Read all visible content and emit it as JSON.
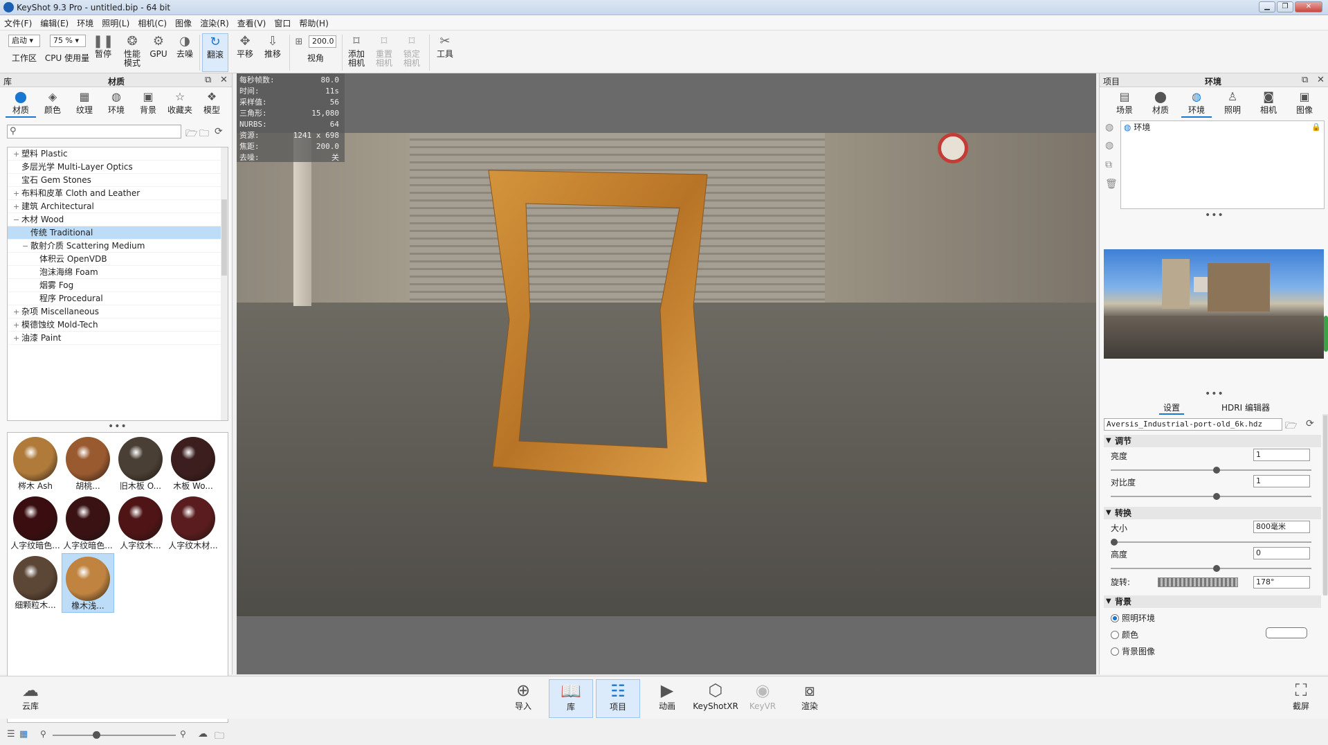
{
  "window": {
    "title": "KeyShot 9.3 Pro  - untitled.bip - 64 bit"
  },
  "menu": [
    "文件(F)",
    "编辑(E)",
    "环境",
    "照明(L)",
    "相机(C)",
    "图像",
    "渲染(R)",
    "查看(V)",
    "窗口",
    "帮助(H)"
  ],
  "toolbar": {
    "workspace_value": "启动",
    "workspace_label": "工作区",
    "cpu_value": "75 %",
    "cpu_label1": "CPU",
    "cpu_label2": "使用量",
    "pause_label": "暂停",
    "perf_label1": "性能",
    "perf_label2": "模式",
    "gpu_label": "GPU",
    "denoise_label": "去噪",
    "tumble_label": "翻滚",
    "pan_label": "平移",
    "dolly_label": "推移",
    "fov_value": "200.0",
    "fov_label": "视角",
    "addcam_label1": "添加",
    "addcam_label2": "相机",
    "resetcam_label1": "重置",
    "resetcam_label2": "相机",
    "lockcam_label1": "锁定",
    "lockcam_label2": "相机",
    "tools_label": "工具"
  },
  "library": {
    "header_left": "库",
    "header_center": "材质",
    "tabs": [
      "材质",
      "颜色",
      "纹理",
      "环境",
      "背景",
      "收藏夹",
      "模型"
    ],
    "tree": [
      {
        "label": "塑料 Plastic",
        "level": 1,
        "exp": "+"
      },
      {
        "label": "多层光学 Multi-Layer Optics",
        "level": 1,
        "exp": ""
      },
      {
        "label": "宝石 Gem Stones",
        "level": 1,
        "exp": ""
      },
      {
        "label": "布料和皮革 Cloth and Leather",
        "level": 1,
        "exp": "+"
      },
      {
        "label": "建筑 Architectural",
        "level": 1,
        "exp": "+"
      },
      {
        "label": "木材 Wood",
        "level": 1,
        "exp": "−"
      },
      {
        "label": "传统 Traditional",
        "level": 2,
        "exp": "",
        "selected": true
      },
      {
        "label": "散射介质 Scattering Medium",
        "level": 2,
        "exp": "−"
      },
      {
        "label": "体积云 OpenVDB",
        "level": 3,
        "exp": ""
      },
      {
        "label": "泡沫海绵 Foam",
        "level": 3,
        "exp": ""
      },
      {
        "label": "烟雾 Fog",
        "level": 3,
        "exp": ""
      },
      {
        "label": "程序 Procedural",
        "level": 3,
        "exp": ""
      },
      {
        "label": "杂项 Miscellaneous",
        "level": 1,
        "exp": "+"
      },
      {
        "label": "模德蚀纹 Mold-Tech",
        "level": 1,
        "exp": "+"
      },
      {
        "label": "油漆 Paint",
        "level": 1,
        "exp": "+"
      }
    ],
    "thumbnails": [
      {
        "label": "梣木 Ash",
        "color": "#b07a3a"
      },
      {
        "label": "胡桃...",
        "color": "#9a5a30"
      },
      {
        "label": "旧木板 O...",
        "color": "#4a3f34"
      },
      {
        "label": "木板 Wo...",
        "color": "#3c1e1e"
      },
      {
        "label": "人字纹暗色...",
        "color": "#3a0d10"
      },
      {
        "label": "人字纹暗色...",
        "color": "#3a1214"
      },
      {
        "label": "人字纹木...",
        "color": "#4e1416"
      },
      {
        "label": "人字纹木材...",
        "color": "#5a1c1e"
      },
      {
        "label": "细颗粒木...",
        "color": "#5c4636"
      },
      {
        "label": "橡木浅...",
        "color": "#c08440",
        "selected": true
      }
    ]
  },
  "stats": [
    {
      "label": "每秒帧数:",
      "value": "80.0"
    },
    {
      "label": "时间:",
      "value": "11s"
    },
    {
      "label": "采样值:",
      "value": "56"
    },
    {
      "label": "三角形:",
      "value": "15,080"
    },
    {
      "label": "NURBS:",
      "value": "64"
    },
    {
      "label": "资源:",
      "value": "1241 x 698"
    },
    {
      "label": "焦距:",
      "value": "200.0"
    },
    {
      "label": "去噪:",
      "value": "关"
    }
  ],
  "project": {
    "header_left": "项目",
    "header_center": "环境",
    "tabs": [
      "场景",
      "材质",
      "环境",
      "照明",
      "相机",
      "图像"
    ],
    "env_item": "环境",
    "subtabs": [
      "设置",
      "HDRI 编辑器"
    ],
    "hdri_path": "Aversis_Industrial-port-old_6k.hdz",
    "sections": {
      "adjust": "调节",
      "transform": "转换",
      "background": "背景"
    },
    "params": {
      "brightness_label": "亮度",
      "brightness_value": "1",
      "contrast_label": "对比度",
      "contrast_value": "1",
      "size_label": "大小",
      "size_value": "800毫米",
      "height_label": "高度",
      "height_value": "0",
      "rotation_label": "旋转:",
      "rotation_value": "178°"
    },
    "background_options": [
      "照明环境",
      "颜色",
      "背景图像"
    ]
  },
  "bottombar": {
    "cloud": "云库",
    "import": "导入",
    "library": "库",
    "project": "项目",
    "animation": "动画",
    "keyshotxr": "KeyShotXR",
    "keyvr": "KeyVR",
    "render": "渲染",
    "screenshot": "截屏"
  }
}
